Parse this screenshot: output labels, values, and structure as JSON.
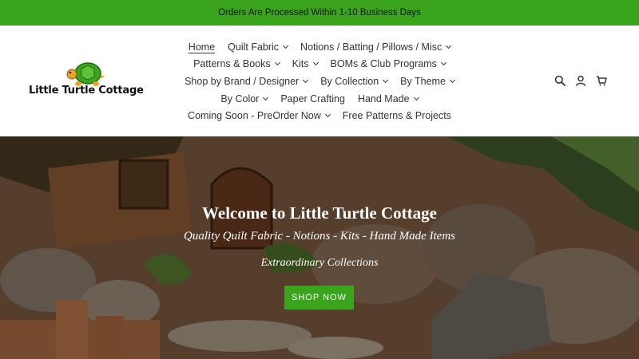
{
  "announcement": {
    "text": "Orders Are Processed Within 1-10 Business Days"
  },
  "brand": {
    "name": "Little Turtle Cottage",
    "logo_icon": "turtle-icon"
  },
  "nav": {
    "rows": [
      [
        {
          "label": "Home",
          "dropdown": false,
          "active": true
        },
        {
          "label": "Quilt Fabric",
          "dropdown": true
        },
        {
          "label": "Notions / Batting / Pillows / Misc",
          "dropdown": true
        }
      ],
      [
        {
          "label": "Patterns & Books",
          "dropdown": true
        },
        {
          "label": "Kits",
          "dropdown": true
        },
        {
          "label": "BOMs & Club Programs",
          "dropdown": true
        }
      ],
      [
        {
          "label": "Shop by Brand / Designer",
          "dropdown": true
        },
        {
          "label": "By Collection",
          "dropdown": true
        },
        {
          "label": "By Theme",
          "dropdown": true
        }
      ],
      [
        {
          "label": "By Color",
          "dropdown": true
        },
        {
          "label": "Paper Crafting",
          "dropdown": false
        },
        {
          "label": "Hand Made",
          "dropdown": true
        }
      ],
      [
        {
          "label": "Coming Soon - PreOrder Now",
          "dropdown": true
        },
        {
          "label": "Free Patterns & Projects",
          "dropdown": false
        }
      ]
    ]
  },
  "header_icons": [
    "search-icon",
    "account-icon",
    "cart-icon"
  ],
  "hero": {
    "title": "Welcome to Little Turtle Cottage",
    "subtitle": "Quality Quilt Fabric - Notions - Kits - Hand Made Items",
    "tagline": "Extraordinary Collections",
    "button_label": "SHOP NOW"
  },
  "colors": {
    "accent": "#3aa51c",
    "text": "#333333"
  }
}
